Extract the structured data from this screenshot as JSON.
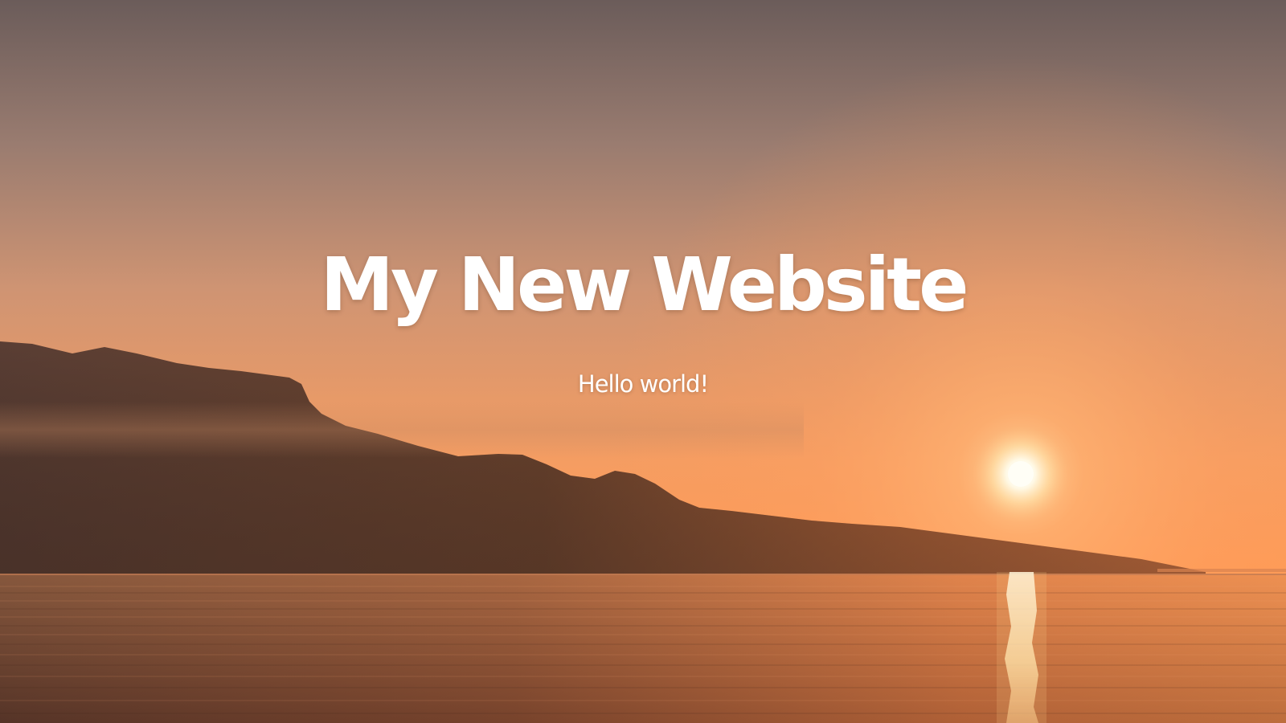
{
  "hero": {
    "title": "My New Website",
    "subtitle": "Hello world!",
    "background_image": "sunset-over-lake-with-mountains",
    "colors": {
      "sky_top": "#6e5f5d",
      "sky_mid": "#c6917a",
      "sky_glow": "#ffac70",
      "sun": "#fffdf0",
      "water": "#b5643c",
      "text": "#ffffff"
    }
  }
}
